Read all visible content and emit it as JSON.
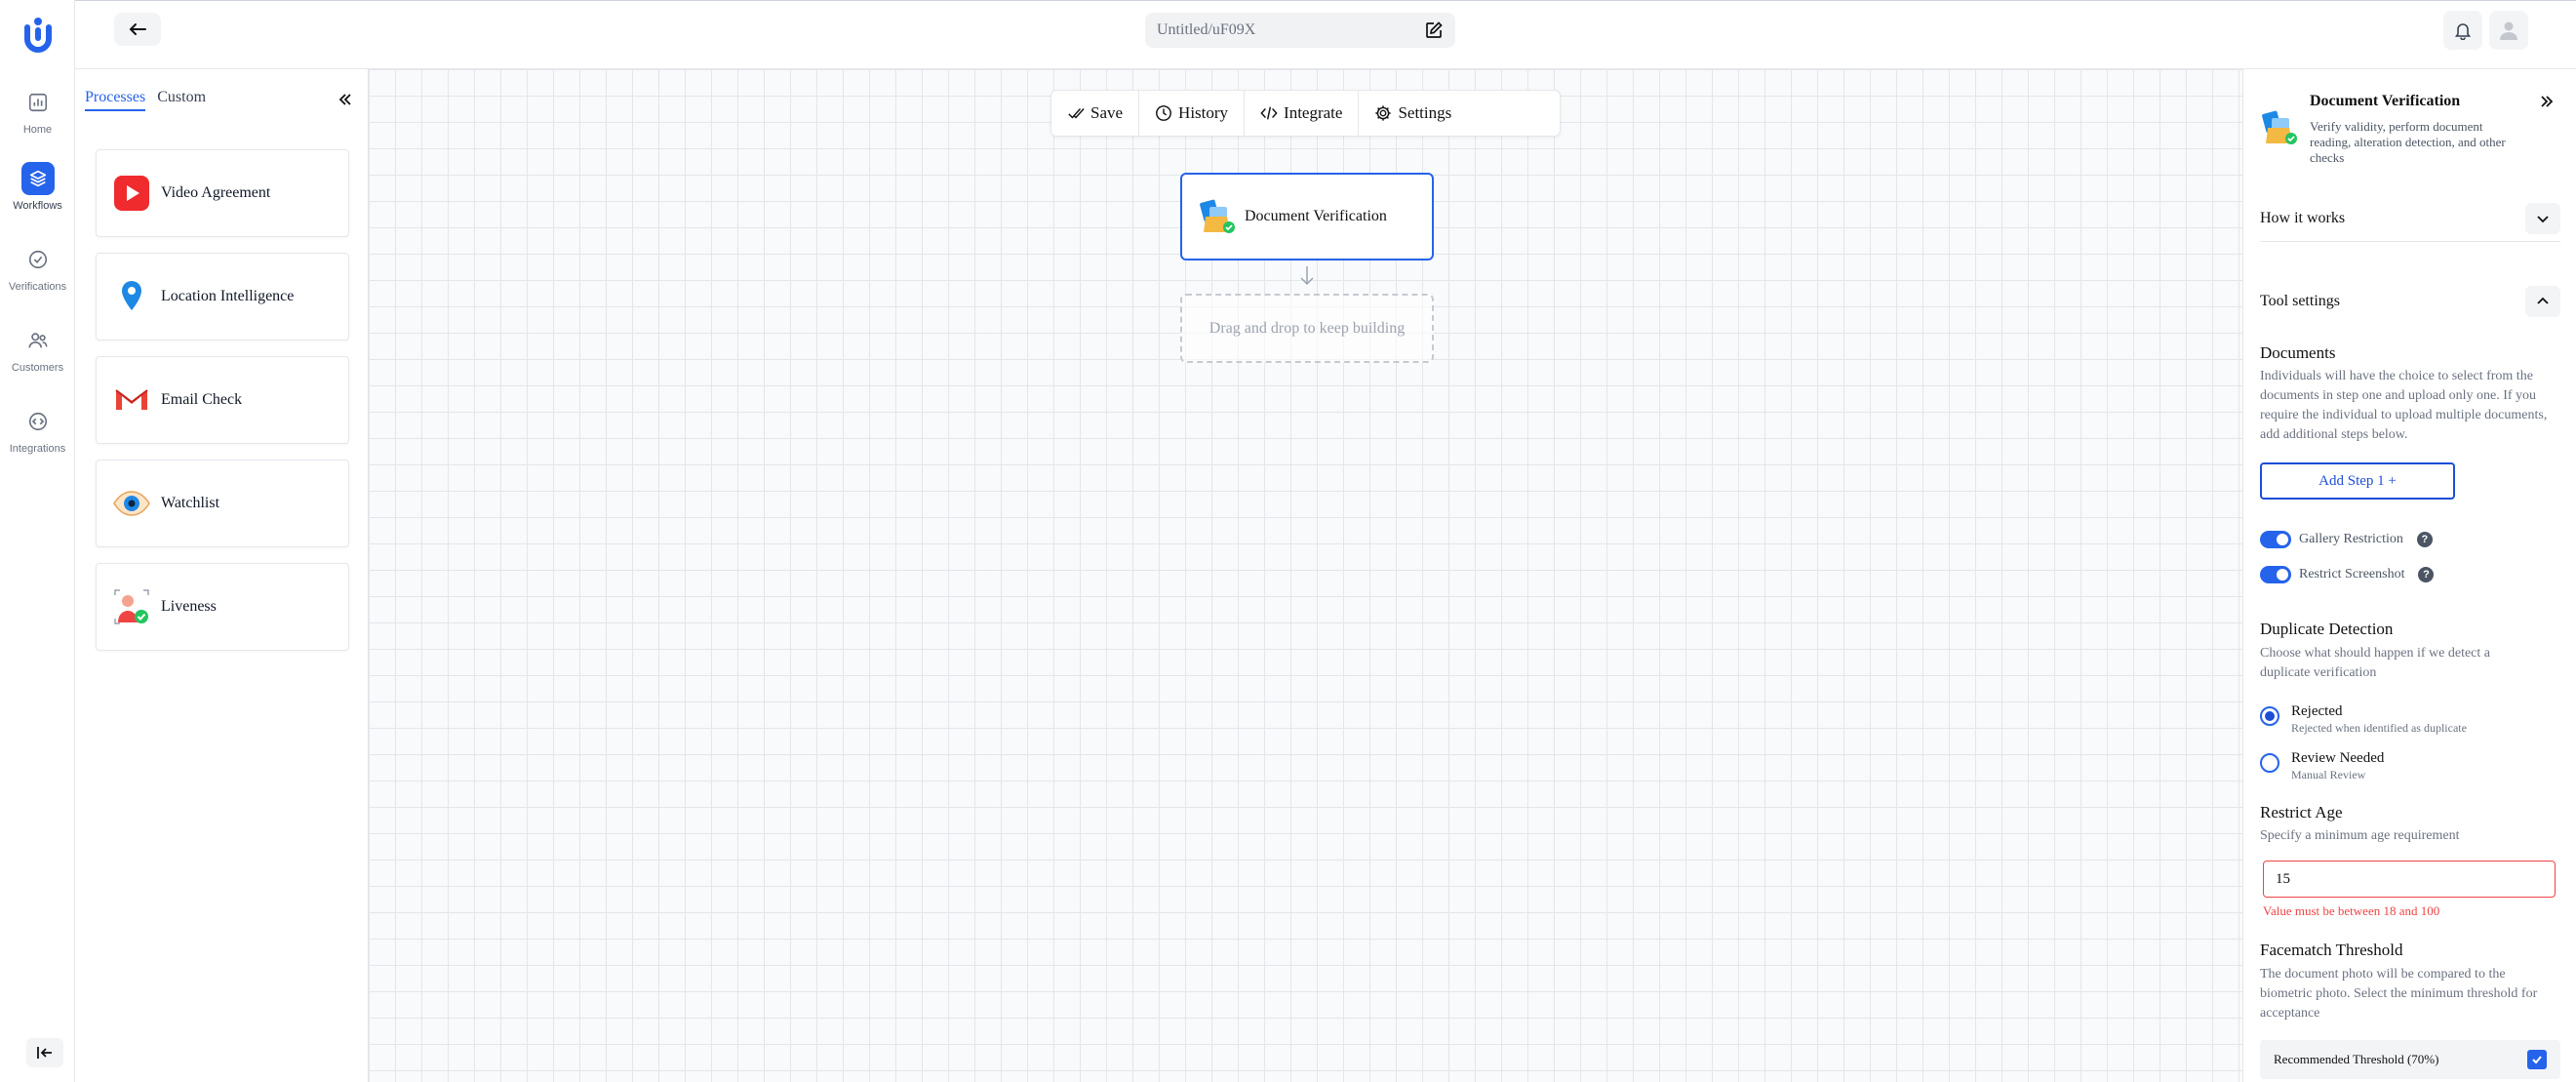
{
  "rail": {
    "items": [
      {
        "label": "Home",
        "icon": "chart-bar-icon"
      },
      {
        "label": "Workflows",
        "icon": "layers-icon",
        "active": true
      },
      {
        "label": "Verifications",
        "icon": "check-circle-icon"
      },
      {
        "label": "Customers",
        "icon": "users-icon"
      },
      {
        "label": "Integrations",
        "icon": "code-icon"
      }
    ]
  },
  "topbar": {
    "title": "Untitled/uF09X"
  },
  "sidebar": {
    "tabs": [
      "Processes",
      "Custom"
    ],
    "processes": [
      {
        "label": "Video Agreement",
        "icon": "video-play-icon"
      },
      {
        "label": "Location Intelligence",
        "icon": "location-pin-icon"
      },
      {
        "label": "Email Check",
        "icon": "gmail-icon"
      },
      {
        "label": "Watchlist",
        "icon": "eye-icon"
      },
      {
        "label": "Liveness",
        "icon": "person-check-icon"
      }
    ]
  },
  "toolbar": {
    "save": "Save",
    "history": "History",
    "integrate": "Integrate",
    "settings": "Settings"
  },
  "canvas": {
    "node_label": "Document Verification",
    "dropzone_text": "Drag and drop to keep building"
  },
  "panel": {
    "title": "Document Verification",
    "description": "Verify validity, perform document reading, alteration detection, and other checks",
    "how_it_works": "How it works",
    "tool_settings": "Tool settings",
    "documents": {
      "title": "Documents",
      "text": "Individuals will have the choice to select from the documents in step one and upload only one. If you require the individual to upload multiple documents, add additional steps below.",
      "add_step": "Add Step 1  +"
    },
    "toggles": [
      {
        "label": "Gallery Restriction",
        "on": true
      },
      {
        "label": "Restrict Screenshot",
        "on": true
      }
    ],
    "duplicate": {
      "title": "Duplicate Detection",
      "text": "Choose what should happen if we detect a duplicate verification",
      "options": [
        {
          "label": "Rejected",
          "sub": "Rejected when identified as duplicate",
          "checked": true
        },
        {
          "label": "Review Needed",
          "sub": "Manual Review",
          "checked": false
        }
      ]
    },
    "age": {
      "title": "Restrict Age",
      "text": "Specify a minimum age requirement",
      "value": "15",
      "error": "Value must be between 18 and 100"
    },
    "facematch": {
      "title": "Facematch Threshold",
      "text": "The document photo will be compared to the biometric photo. Select the minimum threshold for acceptance",
      "option": "Recommended Threshold (70%)"
    }
  },
  "colors": {
    "accent": "#2563eb",
    "error": "#ef4444"
  }
}
